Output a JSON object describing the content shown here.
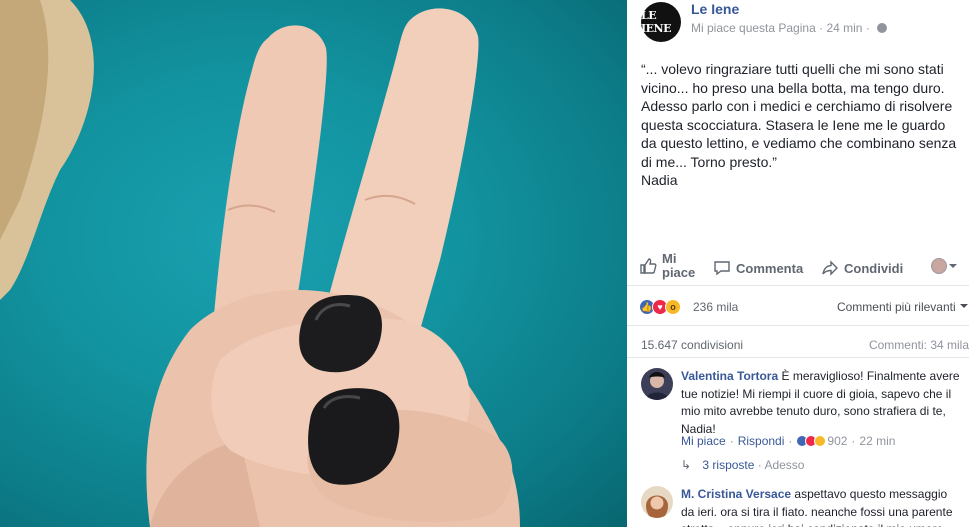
{
  "page": {
    "name": "Le Iene",
    "logo_text": "LE IENE",
    "like_status": "Mi piace questa Pagina",
    "time": "24 min"
  },
  "post": {
    "text": "“... volevo ringraziare tutti quelli che mi sono stati vicino... ho preso una bella botta, ma tengo duro. Adesso parlo con i medici e cerchiamo di risolvere questa scocciatura. Stasera le Iene me le guardo da questo lettino, e vediamo che combinano senza di me... Torno presto.”\nNadia"
  },
  "actions": {
    "like": "Mi piace",
    "comment": "Commenta",
    "share": "Condividi"
  },
  "stats": {
    "reactions_count": "236 mila",
    "sort_label": "Commenti più rilevanti",
    "shares": "15.647 condivisioni",
    "comments": "Commenti: 34 mila"
  },
  "comments": [
    {
      "author": "Valentina Tortora",
      "text": "È meraviglioso! Finalmente avere tue notizie! Mi riempi il cuore di gioia, sapevo che il mio mito avrebbe tenuto duro, sono strafiera di te, Nadia!",
      "like_label": "Mi piace",
      "reply_label": "Rispondi",
      "reaction_count": "902",
      "time": "22 min",
      "replies_label": "3 risposte",
      "replies_time": "Adesso"
    },
    {
      "author": "M. Cristina Versace",
      "text": "aspettavo questo messaggio da ieri. ora si tira il fiato. neanche fossi una parente stretta... eppure ieri hai condizionato il mio umore"
    }
  ],
  "colors": {
    "link_blue": "#385898",
    "like_blue": "#4267b2",
    "love_red": "#f0284a",
    "wow_yellow": "#f7b928",
    "background_teal": "#12939f"
  }
}
